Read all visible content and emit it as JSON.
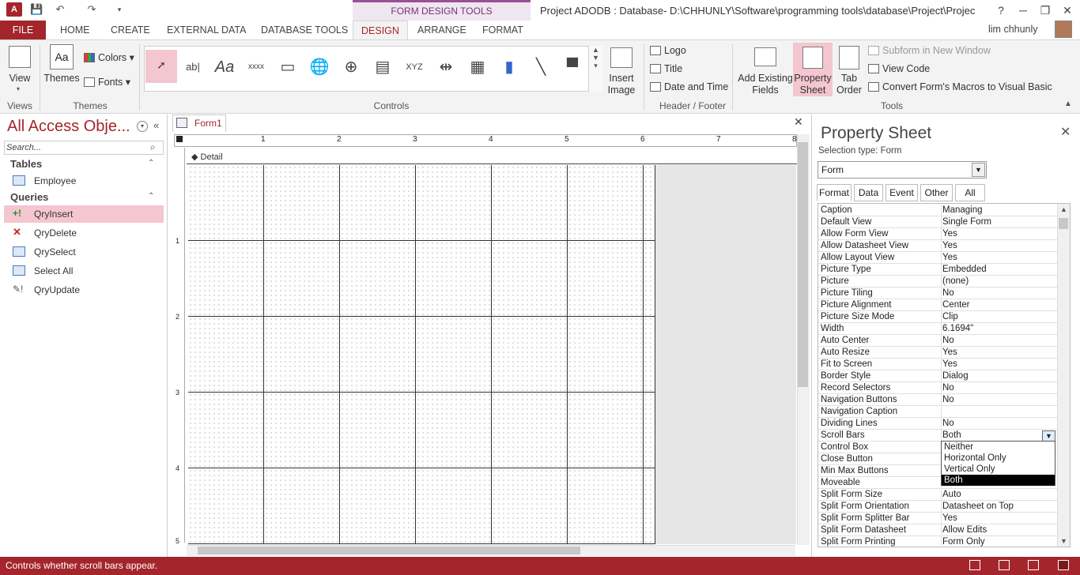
{
  "titlebar": {
    "app_icon": "A",
    "context_header": "FORM DESIGN TOOLS",
    "window_title": "Project ADODB : Database- D:\\CHHUNLY\\Software\\programming tools\\database\\Project\\Project ADO...",
    "help": "?",
    "minimize": "─",
    "restore": "❐",
    "close": "✕"
  },
  "tabs": [
    "FILE",
    "HOME",
    "CREATE",
    "EXTERNAL DATA",
    "DATABASE TOOLS",
    "DESIGN",
    "ARRANGE",
    "FORMAT"
  ],
  "user": {
    "name": "lim chhunly"
  },
  "ribbon": {
    "views": {
      "view_label": "View",
      "group": "Views"
    },
    "themes": {
      "themes_label": "Themes",
      "colors_label": "Colors",
      "fonts_label": "Fonts",
      "group": "Themes"
    },
    "controls": {
      "group": "Controls",
      "textbox": "ab|",
      "label": "Aa",
      "button": "xxxx",
      "xyz": "XYZ"
    },
    "insert_image": {
      "line1": "Insert",
      "line2": "Image"
    },
    "header_footer": {
      "logo": "Logo",
      "title": "Title",
      "date_time": "Date and Time",
      "group": "Header / Footer"
    },
    "tools": {
      "add_existing_1": "Add Existing",
      "add_existing_2": "Fields",
      "property_sheet_1": "Property",
      "property_sheet_2": "Sheet",
      "tab_order_1": "Tab",
      "tab_order_2": "Order",
      "subform": "Subform in New Window",
      "view_code": "View Code",
      "convert_macros": "Convert Form's Macros to Visual Basic",
      "group": "Tools"
    }
  },
  "nav": {
    "title": "All Access Obje...",
    "search_placeholder": "Search...",
    "tables_header": "Tables",
    "tables": [
      "Employee"
    ],
    "queries_header": "Queries",
    "queries": [
      "QryInsert",
      "QryDelete",
      "QrySelect",
      "Select All",
      "QryUpdate"
    ]
  },
  "document": {
    "tab": "Form1",
    "detail": "Detail",
    "ruler_marks": [
      "1",
      "2",
      "3",
      "4",
      "5",
      "6",
      "7",
      "8"
    ],
    "vruler_marks": [
      "1",
      "2",
      "3",
      "4",
      "5"
    ]
  },
  "property_sheet": {
    "title": "Property Sheet",
    "selection_type": "Selection type:  Form",
    "selected_object": "Form",
    "tabs": [
      "Format",
      "Data",
      "Event",
      "Other",
      "All"
    ],
    "active_tab": "Format",
    "rows": [
      {
        "name": "Caption",
        "value": "Managing"
      },
      {
        "name": "Default View",
        "value": "Single Form"
      },
      {
        "name": "Allow Form View",
        "value": "Yes"
      },
      {
        "name": "Allow Datasheet View",
        "value": "Yes"
      },
      {
        "name": "Allow Layout View",
        "value": "Yes"
      },
      {
        "name": "Picture Type",
        "value": "Embedded"
      },
      {
        "name": "Picture",
        "value": "(none)"
      },
      {
        "name": "Picture Tiling",
        "value": "No"
      },
      {
        "name": "Picture Alignment",
        "value": "Center"
      },
      {
        "name": "Picture Size Mode",
        "value": "Clip"
      },
      {
        "name": "Width",
        "value": "6.1694\""
      },
      {
        "name": "Auto Center",
        "value": "No"
      },
      {
        "name": "Auto Resize",
        "value": "Yes"
      },
      {
        "name": "Fit to Screen",
        "value": "Yes"
      },
      {
        "name": "Border Style",
        "value": "Dialog"
      },
      {
        "name": "Record Selectors",
        "value": "No"
      },
      {
        "name": "Navigation Buttons",
        "value": "No"
      },
      {
        "name": "Navigation Caption",
        "value": ""
      },
      {
        "name": "Dividing Lines",
        "value": "No"
      },
      {
        "name": "Scroll Bars",
        "value": "Both"
      },
      {
        "name": "Control Box",
        "value": ""
      },
      {
        "name": "Close Button",
        "value": ""
      },
      {
        "name": "Min Max Buttons",
        "value": ""
      },
      {
        "name": "Moveable",
        "value": ""
      },
      {
        "name": "Split Form Size",
        "value": "Auto"
      },
      {
        "name": "Split Form Orientation",
        "value": "Datasheet on Top"
      },
      {
        "name": "Split Form Splitter Bar",
        "value": "Yes"
      },
      {
        "name": "Split Form Datasheet",
        "value": "Allow Edits"
      },
      {
        "name": "Split Form Printing",
        "value": "Form Only"
      }
    ],
    "scroll_bars_options": [
      "Neither",
      "Horizontal Only",
      "Vertical Only",
      "Both"
    ],
    "scroll_bars_selected": "Both"
  },
  "status": {
    "text": "Controls whether scroll bars appear."
  },
  "colors": {
    "accent": "#a4262c",
    "context": "#9b4f96",
    "selected": "#f4c6cf"
  }
}
